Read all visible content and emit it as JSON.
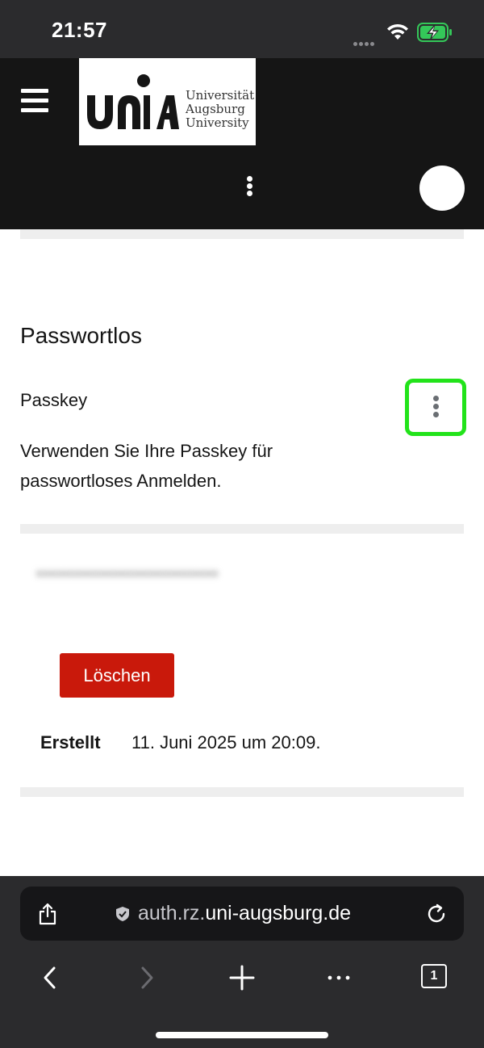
{
  "status_bar": {
    "time": "21:57"
  },
  "header": {
    "logo": {
      "line1": "Universität",
      "line2": "Augsburg",
      "line3": "University"
    }
  },
  "content": {
    "section_title": "Passwortlos",
    "item_title": "Passkey",
    "item_description": "Verwenden Sie Ihre Passkey für passwortloses Anmelden.",
    "blurred_label": "••••••••••••••••••••••••••",
    "delete_label": "Löschen",
    "created_label": "Erstellt",
    "created_value": "11. Juni 2025 um 20:09."
  },
  "browser": {
    "url_prefix": "auth.rz.",
    "url_domain": "uni-augsburg.de",
    "tab_count": "1"
  },
  "colors": {
    "header_bg": "#151515",
    "delete_button": "#c9190b",
    "highlight": "#22e31a",
    "battery": "#34c759"
  },
  "icons": [
    "hamburger-menu-icon",
    "kebab-menu-icon",
    "avatar-icon",
    "wifi-icon",
    "battery-charging-icon",
    "share-icon",
    "shield-icon",
    "reload-icon",
    "back-icon",
    "forward-icon",
    "plus-icon",
    "more-icon",
    "tabs-icon"
  ]
}
